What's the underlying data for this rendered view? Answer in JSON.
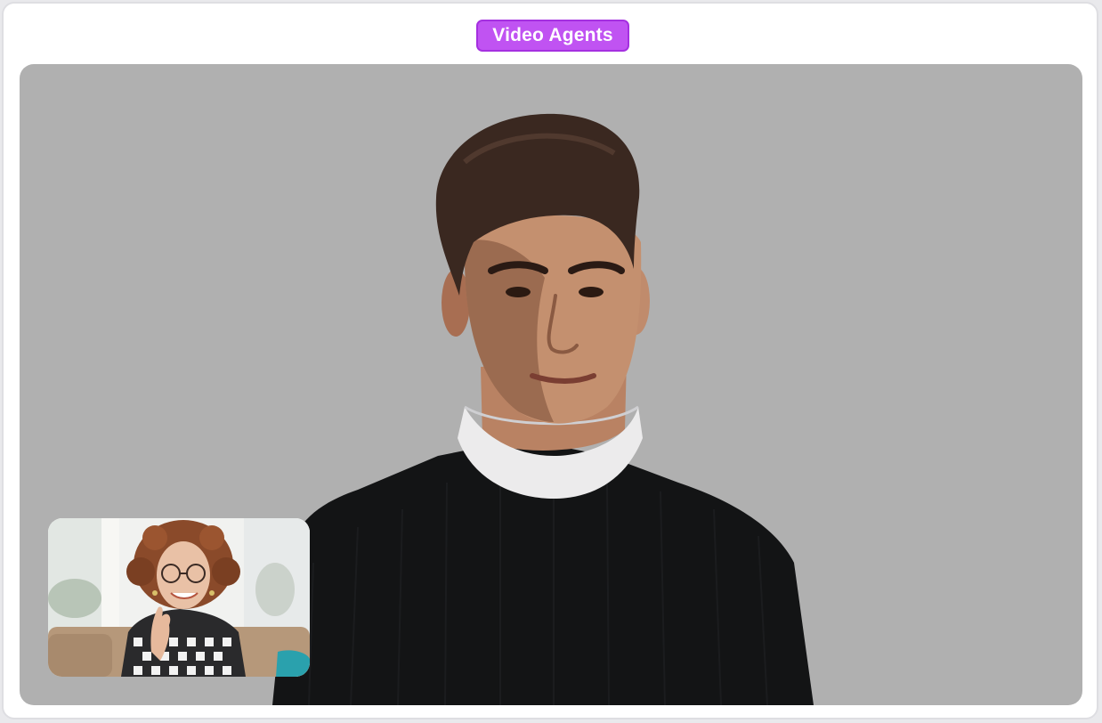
{
  "header": {
    "badge_label": "Video Agents"
  },
  "stage": {
    "main_feed": "ai-agent-video",
    "self_view": "user-camera-thumbnail"
  },
  "colors": {
    "badge_bg": "#c053f2",
    "stage_bg": "#b0b0b0",
    "card_bg": "#ffffff"
  }
}
